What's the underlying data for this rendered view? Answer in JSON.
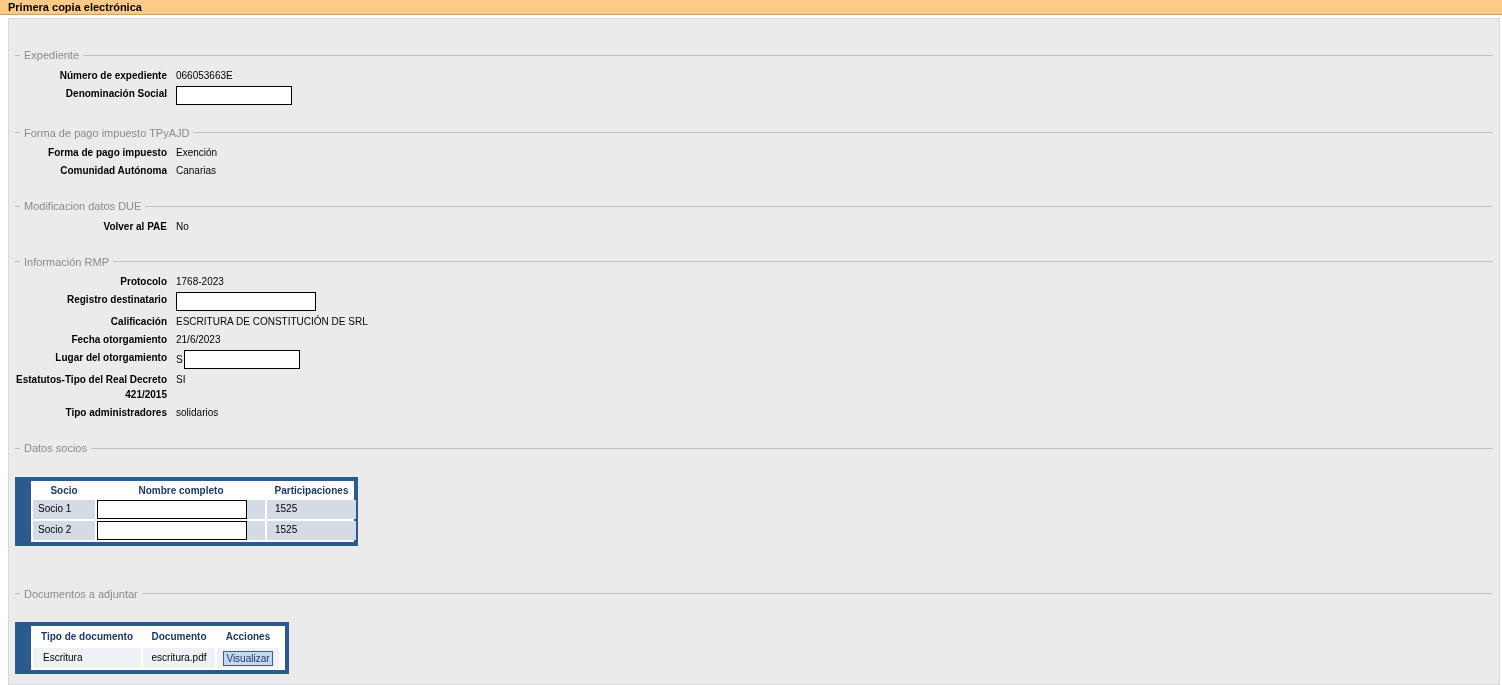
{
  "header": {
    "title": "Primera copia electrónica"
  },
  "sections": [
    {
      "legend": "Expediente",
      "fields": [
        {
          "label": "Número de expediente",
          "value": "066053663E",
          "redacted": false
        },
        {
          "label": "Denominación Social",
          "redacted": true
        }
      ]
    },
    {
      "legend": "Forma de pago impuesto TPyAJD",
      "fields": [
        {
          "label": "Forma de pago impuesto",
          "value": "Exención",
          "redacted": false
        },
        {
          "label": "Comunidad Autónoma",
          "value": "Canarias",
          "redacted": false
        }
      ]
    },
    {
      "legend": "Modificacion datos DUE",
      "fields": [
        {
          "label": "Volver al PAE",
          "value": "No",
          "redacted": false
        }
      ]
    },
    {
      "legend": "Información RMP",
      "fields": [
        {
          "label": "Protocolo",
          "value": "1768-2023",
          "redacted": false
        },
        {
          "label": "Registro destinatario",
          "redacted": true
        },
        {
          "label": "Calificación",
          "value": "ESCRITURA DE CONSTITUCIÓN DE SRL",
          "redacted": false
        },
        {
          "label": "Fecha otorgamiento",
          "value": "21/6/2023",
          "redacted": false
        },
        {
          "label": "Lugar del otorgamiento",
          "value": "S",
          "redacted": true
        },
        {
          "label": "Estatutos-Tipo del Real Decreto 421/2015",
          "value": "SI",
          "redacted": false
        },
        {
          "label": "Tipo administradores",
          "value": "solidarios",
          "redacted": false
        }
      ]
    }
  ],
  "socios": {
    "legend": "Datos socios",
    "columns": [
      "Socio",
      "Nombre completo",
      "Participaciones"
    ],
    "rows": [
      {
        "socio": "Socio 1",
        "nombre_redacted": true,
        "participaciones": "1525"
      },
      {
        "socio": "Socio 2",
        "nombre_redacted": true,
        "participaciones": "1525"
      }
    ]
  },
  "documentos": {
    "legend": "Documentos a adjuntar",
    "columns": [
      "Tipo de documento",
      "Documento",
      "Acciones"
    ],
    "rows": [
      {
        "tipo": "Escritura",
        "documento": "escritura.pdf",
        "action": "Visualizar"
      }
    ]
  }
}
